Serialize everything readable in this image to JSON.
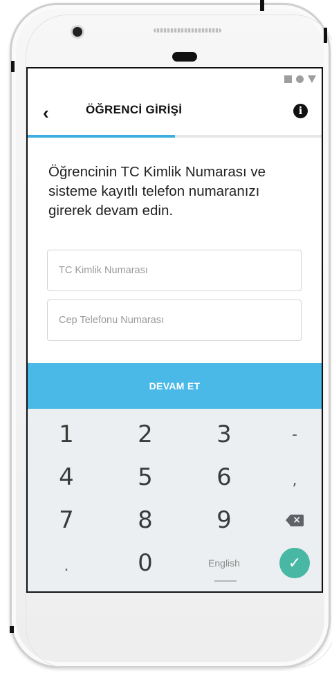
{
  "header": {
    "back_icon": "chevron-left-icon",
    "title": "ÖĞRENCİ GİRİŞİ",
    "info_icon": "info-icon",
    "progress": 0.5,
    "accent_color": "#3eaee0"
  },
  "status_icons": [
    "stop-square-icon",
    "circle-icon",
    "triangle-down-icon"
  ],
  "intro_text": "Öğrencinin TC Kimlik Numarası ve sisteme kayıtlı telefon numaranızı girerek devam edin.",
  "form": {
    "tc_placeholder": "TC Kimlik Numarası",
    "phone_placeholder": "Cep Telefonu Numarası",
    "tc_value": "",
    "phone_value": "",
    "submit_label": "DEVAM ET",
    "submit_color": "#4bb9e8"
  },
  "keypad": {
    "keys": [
      "1",
      "2",
      "3",
      "-",
      "4",
      "5",
      "6",
      ",",
      "7",
      "8",
      "9",
      ".",
      "0"
    ],
    "language": "English",
    "done_color": "#48b8a4"
  }
}
